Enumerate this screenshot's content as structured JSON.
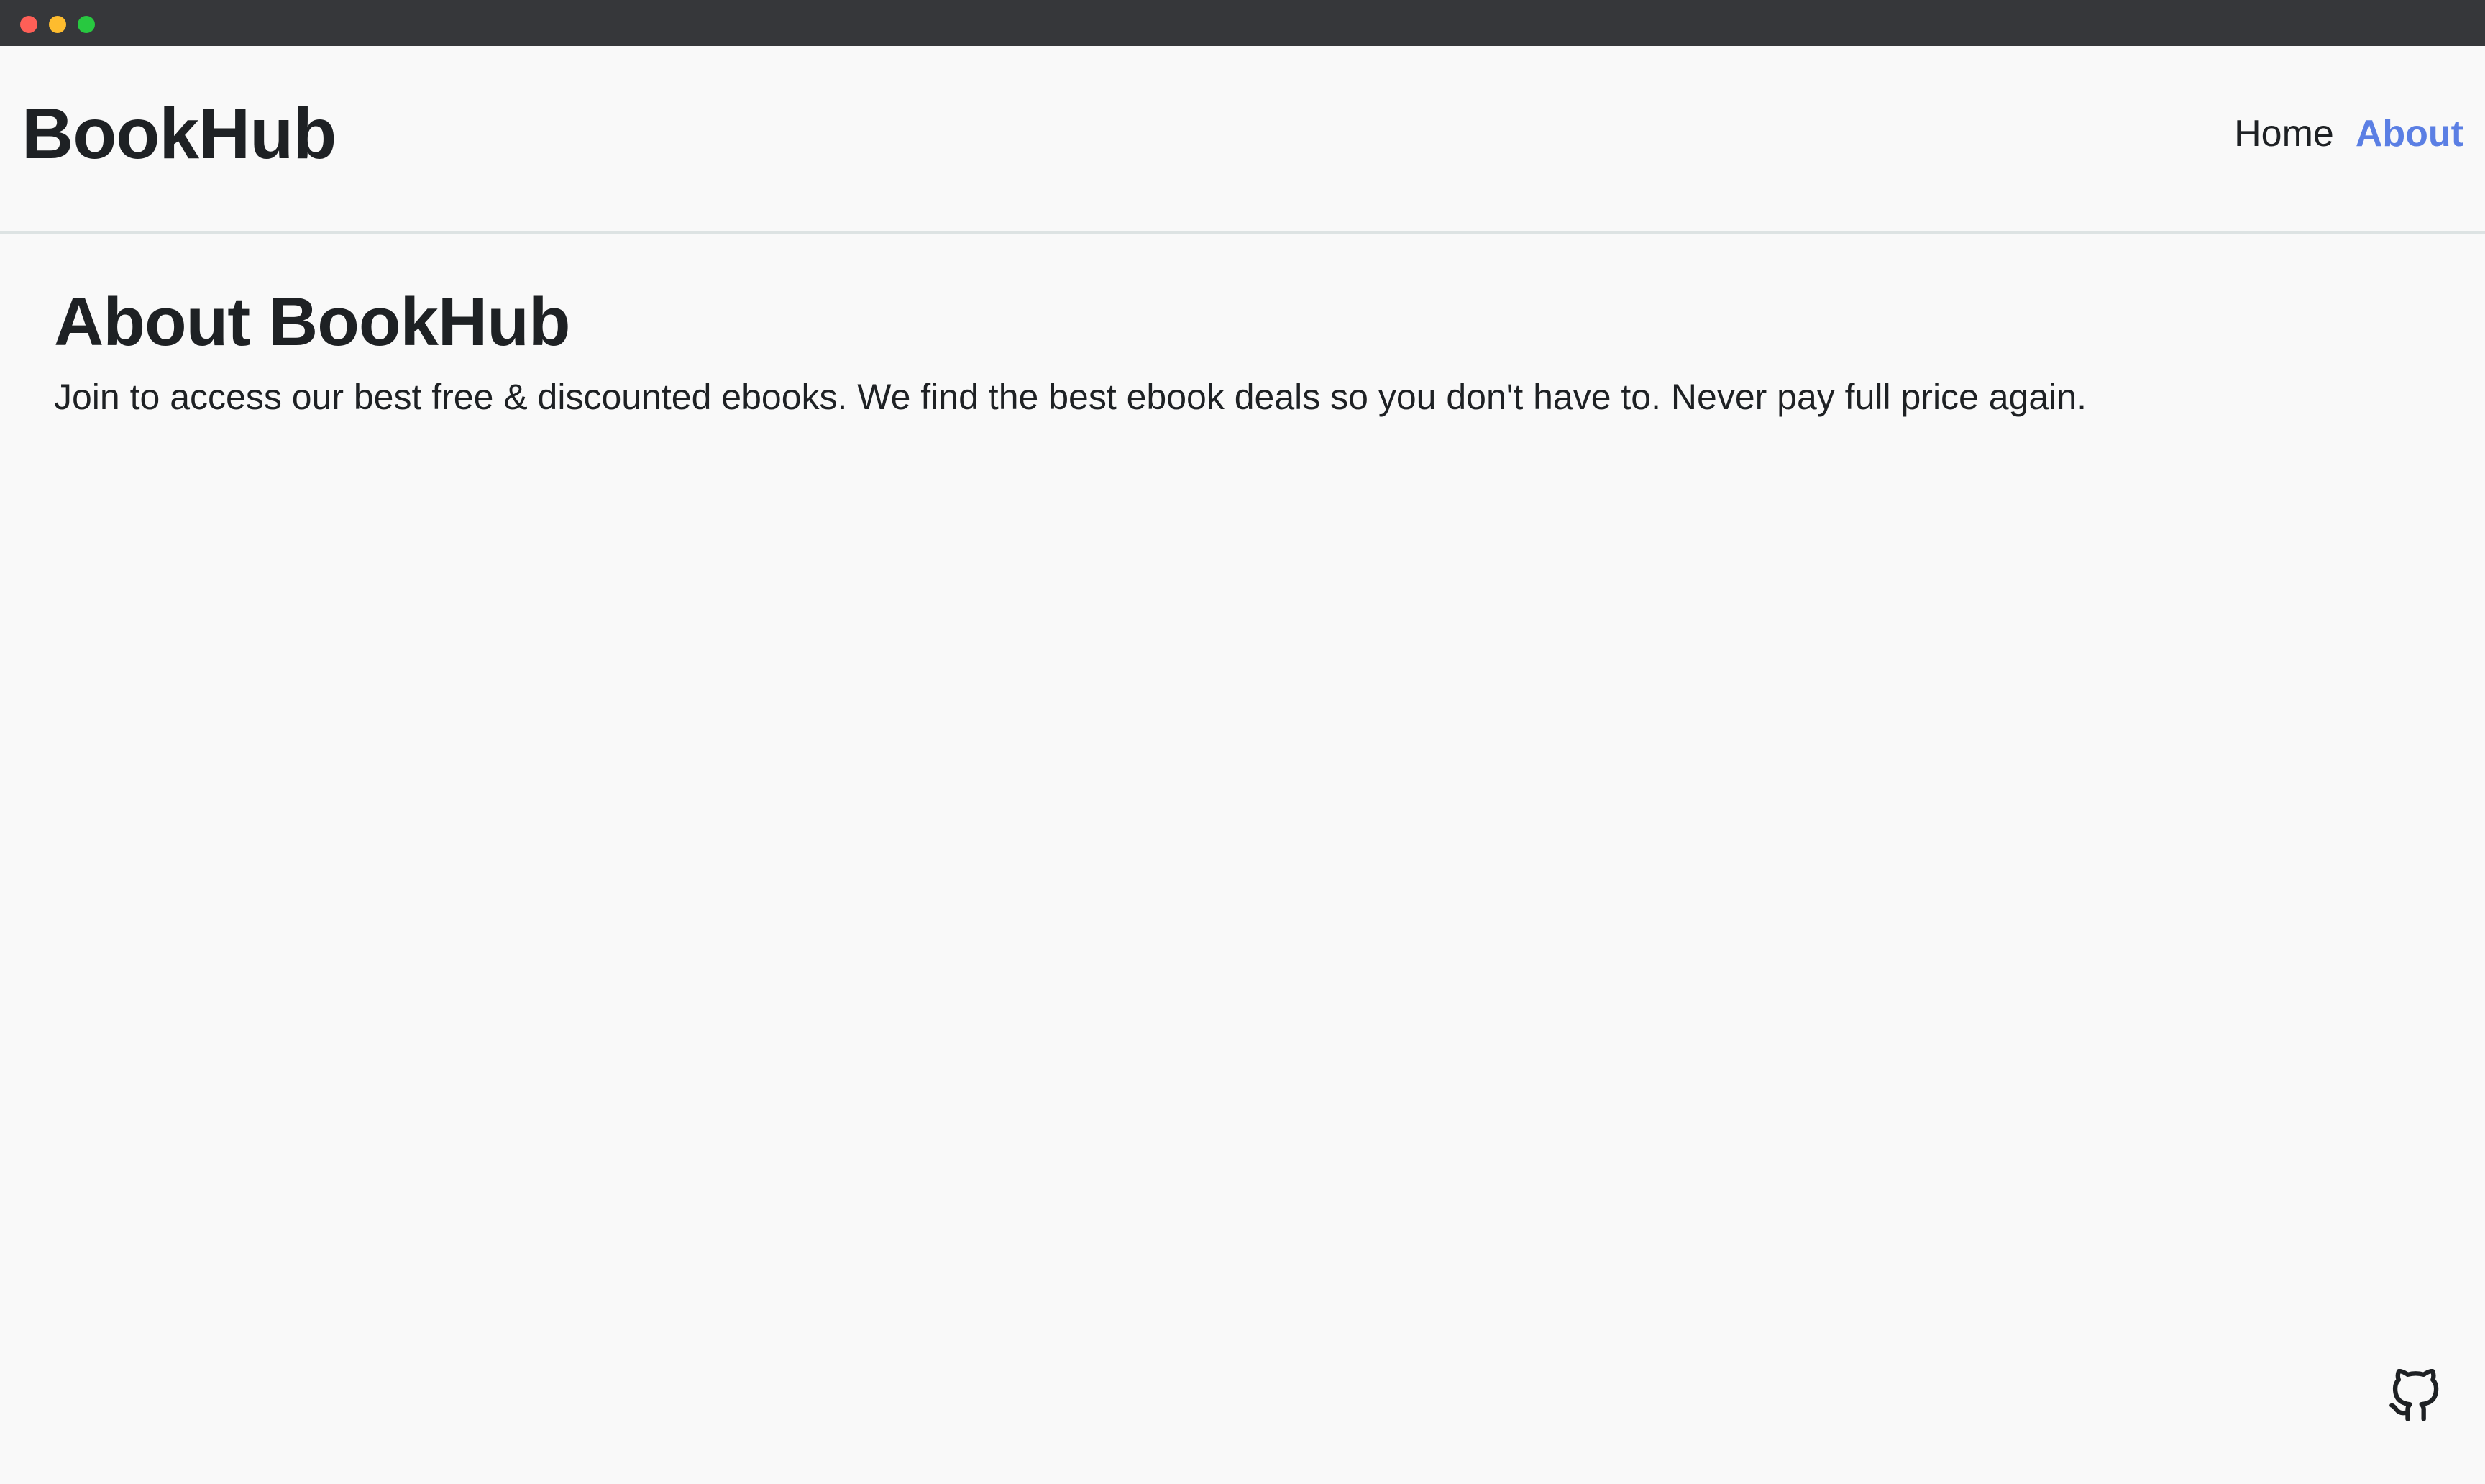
{
  "window": {
    "controls": [
      "close-button",
      "minimize-button",
      "maximize-button"
    ]
  },
  "header": {
    "logo": "BookHub",
    "nav": [
      {
        "label": "Home",
        "active": false
      },
      {
        "label": "About",
        "active": true
      }
    ]
  },
  "main": {
    "title": "About BookHub",
    "description": "Join to access our best free & discounted ebooks. We find the best ebook deals so you don't have to. Never pay full price again."
  },
  "footer": {
    "icon": "github-icon"
  },
  "colors": {
    "accent": "#5b7fe4",
    "text": "#1e2124",
    "background": "#f9f9f9",
    "divider": "#dde3e3",
    "titlebar": "#36373a"
  }
}
